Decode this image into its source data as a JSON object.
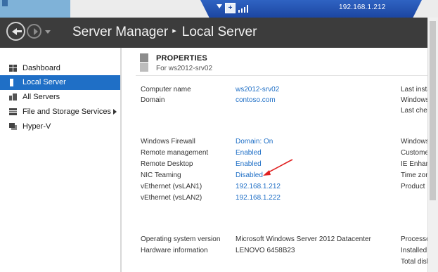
{
  "connection_bar": {
    "address": "192.168.1.212",
    "pin_label": "+"
  },
  "window": {
    "app_title": "Server Manager",
    "breadcrumb_separator": "▸",
    "page_title": "Local Server"
  },
  "sidebar": {
    "items": [
      {
        "label": "Dashboard",
        "icon": "dashboard-icon",
        "selected": false
      },
      {
        "label": "Local Server",
        "icon": "local-server-icon",
        "selected": true
      },
      {
        "label": "All Servers",
        "icon": "all-servers-icon",
        "selected": false
      },
      {
        "label": "File and Storage Services",
        "icon": "file-storage-icon",
        "selected": false,
        "expandable": true
      },
      {
        "label": "Hyper-V",
        "icon": "hyper-v-icon",
        "selected": false
      }
    ]
  },
  "properties": {
    "title": "PROPERTIES",
    "subtitle": "For ws2012-srv02",
    "rows": [
      {
        "label": "Computer name",
        "value": "ws2012-srv02",
        "link": true
      },
      {
        "label": "Domain",
        "value": "contoso.com",
        "link": true
      },
      {
        "label": "Windows Firewall",
        "value": "Domain: On",
        "link": true
      },
      {
        "label": "Remote management",
        "value": "Enabled",
        "link": true
      },
      {
        "label": "Remote Desktop",
        "value": "Enabled",
        "link": true
      },
      {
        "label": "NIC Teaming",
        "value": "Disabled",
        "link": true
      },
      {
        "label": "vEthernet (vsLAN1)",
        "value": "192.168.1.212",
        "link": true
      },
      {
        "label": "vEthernet (vsLAN2)",
        "value": "192.168.1.222",
        "link": true
      },
      {
        "label": "Operating system version",
        "value": "Microsoft Windows Server 2012 Datacenter",
        "link": false
      },
      {
        "label": "Hardware information",
        "value": "LENOVO 6458B23",
        "link": false
      }
    ],
    "right_column": [
      "Last insta",
      "Windows",
      "Last chec",
      "Windows",
      "Custome",
      "IE Enhanc",
      "Time zon",
      "Product I",
      "Processo",
      "Installed",
      "Total disk"
    ]
  },
  "colors": {
    "accent": "#1f6fc6",
    "header_bg": "#3c3c3c",
    "annotation_arrow": "#e02020"
  }
}
